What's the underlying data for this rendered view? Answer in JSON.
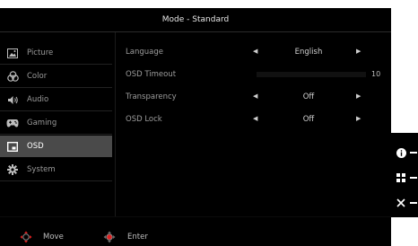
{
  "window": {
    "title": "Mode - Standard"
  },
  "sidebar": {
    "items": [
      {
        "label": "Picture",
        "icon": "picture-icon",
        "active": false
      },
      {
        "label": "Color",
        "icon": "color-icon",
        "active": false
      },
      {
        "label": "Audio",
        "icon": "speaker-icon",
        "active": false
      },
      {
        "label": "Gaming",
        "icon": "gamepad-icon",
        "active": false
      },
      {
        "label": "OSD",
        "icon": "osd-icon",
        "active": true
      },
      {
        "label": "System",
        "icon": "gear-icon",
        "active": false
      }
    ]
  },
  "settings": {
    "language": {
      "label": "Language",
      "value": "English"
    },
    "osd_timeout": {
      "label": "OSD Timeout",
      "value": "10",
      "level": 0.1
    },
    "transparency": {
      "label": "Transparency",
      "value": "Off"
    },
    "osd_lock": {
      "label": "OSD Lock",
      "value": "Off"
    }
  },
  "footer": {
    "move_label": "Move",
    "enter_label": "Enter"
  },
  "keypad": {
    "keys": [
      {
        "icon": "info-icon"
      },
      {
        "icon": "grid-icon"
      },
      {
        "icon": "close-icon"
      }
    ]
  },
  "colors": {
    "background": "#000000",
    "active_item": "#4a4a4a",
    "joystick_accent": "#e02020"
  }
}
